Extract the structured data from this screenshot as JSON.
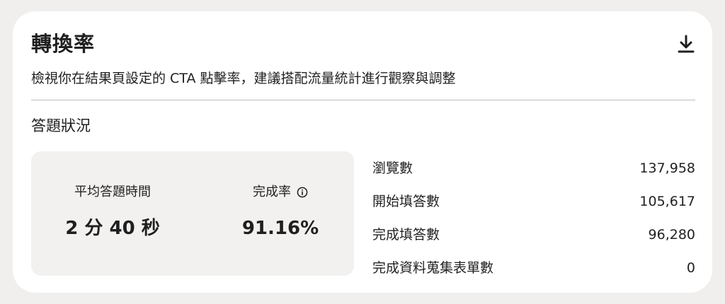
{
  "header": {
    "title": "轉換率",
    "download_icon": "download-icon",
    "subtitle": "檢視你在結果頁設定的 CTA 點擊率，建議搭配流量統計進行觀察與調整"
  },
  "answers": {
    "section_title": "答題狀況",
    "metrics": [
      {
        "label": "平均答題時間",
        "value": "2 分 40 秒"
      },
      {
        "label": "完成率",
        "value": "91.16%",
        "icon": "info-icon"
      }
    ],
    "stats": [
      {
        "label": "瀏覽數",
        "value": "137,958"
      },
      {
        "label": "開始填答數",
        "value": "105,617"
      },
      {
        "label": "完成填答數",
        "value": "96,280"
      },
      {
        "label": "完成資料蒐集表單數",
        "value": "0"
      }
    ]
  }
}
